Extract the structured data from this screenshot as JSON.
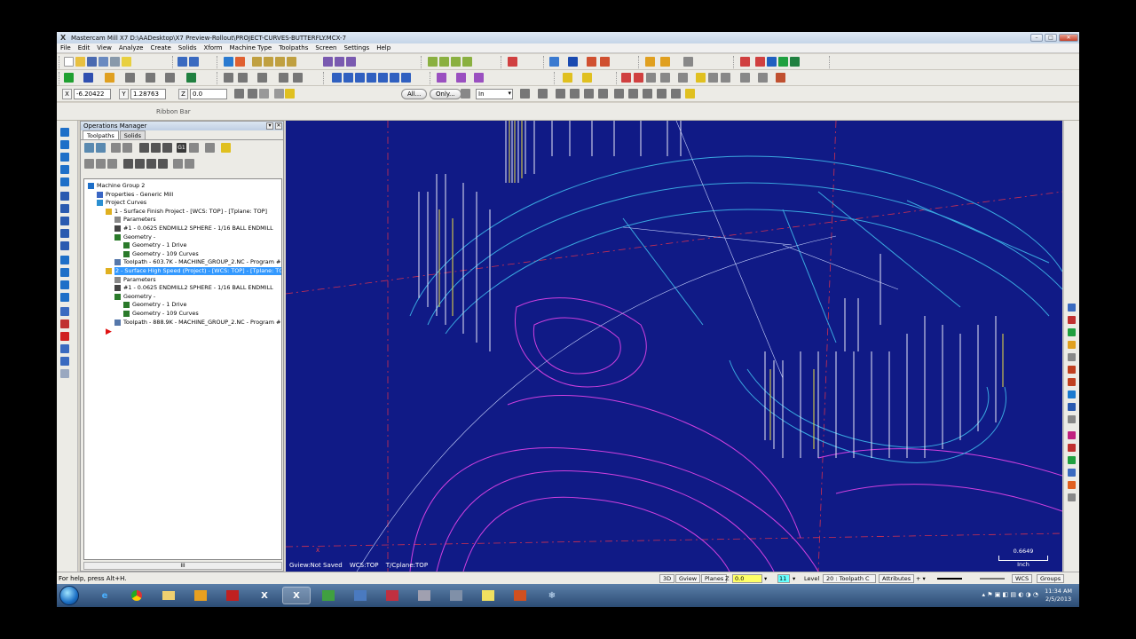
{
  "window": {
    "title": "Mastercam Mill X7  D:\\AADesktop\\X7 Preview-Rollout\\PROJECT-CURVES-BUTTERFLY.MCX-7"
  },
  "menu": [
    "File",
    "Edit",
    "View",
    "Analyze",
    "Create",
    "Solids",
    "Xform",
    "Machine Type",
    "Toolpaths",
    "Screen",
    "Settings",
    "Help"
  ],
  "autocursor": {
    "x_label": "X",
    "x_value": "-6.20422",
    "y_label": "Y",
    "y_value": "1.28763",
    "z_label": "Z",
    "z_value": "0.0"
  },
  "selection": {
    "all_label": "All...",
    "only_label": "Only...",
    "mode_value": "In"
  },
  "ribbon_label": "Ribbon Bar",
  "ops_manager": {
    "title": "Operations Manager",
    "tabs": [
      "Toolpaths",
      "Solids"
    ],
    "tree": [
      {
        "label": "Machine Group 2",
        "depth": 0,
        "icon": "machine-group-icon",
        "color": "#1e6fc8"
      },
      {
        "label": "Properties - Generic Mill",
        "depth": 1,
        "icon": "properties-icon",
        "color": "#3a66c4"
      },
      {
        "label": "Project Curves",
        "depth": 1,
        "icon": "toolpath-group-icon",
        "color": "#2b8fd1"
      },
      {
        "label": "1 - Surface Finish Project - [WCS: TOP] - [Tplane: TOP]",
        "depth": 2,
        "icon": "operation-folder-icon",
        "color": "#e0b020"
      },
      {
        "label": "Parameters",
        "depth": 3,
        "icon": "parameters-icon",
        "color": "#888888"
      },
      {
        "label": "#1 - 0.0625 ENDMILL2 SPHERE - 1/16 BALL ENDMILL",
        "depth": 3,
        "icon": "tool-icon",
        "color": "#444444"
      },
      {
        "label": "Geometry -",
        "depth": 3,
        "icon": "geometry-icon",
        "color": "#2a7a2a"
      },
      {
        "label": "Geometry - 1 Drive",
        "depth": 4,
        "icon": "geometry-drive-icon",
        "color": "#2a7a2a"
      },
      {
        "label": "Geometry - 109 Curves",
        "depth": 4,
        "icon": "geometry-curves-icon",
        "color": "#2a7a2a"
      },
      {
        "label": "Toolpath - 603.7K - MACHINE_GROUP_2.NC - Program #",
        "depth": 3,
        "icon": "toolpath-file-icon",
        "color": "#5577aa"
      },
      {
        "label": "2 - Surface High Speed (Project) - [WCS: TOP] - [Tplane: TO",
        "depth": 2,
        "icon": "operation-folder-icon",
        "color": "#e0b020",
        "selected": true
      },
      {
        "label": "Parameters",
        "depth": 3,
        "icon": "parameters-icon",
        "color": "#888888"
      },
      {
        "label": "#1 - 0.0625 ENDMILL2 SPHERE - 1/16 BALL ENDMILL",
        "depth": 3,
        "icon": "tool-icon",
        "color": "#444444"
      },
      {
        "label": "Geometry -",
        "depth": 3,
        "icon": "geometry-icon",
        "color": "#2a7a2a"
      },
      {
        "label": "Geometry - 1 Drive",
        "depth": 4,
        "icon": "geometry-drive-icon",
        "color": "#2a7a2a"
      },
      {
        "label": "Geometry - 109 Curves",
        "depth": 4,
        "icon": "geometry-curves-icon",
        "color": "#2a7a2a"
      },
      {
        "label": "Toolpath - 888.9K - MACHINE_GROUP_2.NC - Program #",
        "depth": 3,
        "icon": "toolpath-file-icon",
        "color": "#5577aa"
      }
    ],
    "insert_arrow_icon": "insert-arrow-icon",
    "scroll_thumb": "III"
  },
  "viewport": {
    "gview": "Gview:Not Saved",
    "wcs": "WCS:TOP",
    "tcplane": "T/Cplane:TOP",
    "axis_x": "X",
    "scale_value": "0.6649",
    "scale_unit": "Inch",
    "background": "#101a86"
  },
  "statusbar": {
    "help_text": "For help, press Alt+H.",
    "btn_3d": "3D",
    "btn_gview": "Gview",
    "btn_planes": "Planes",
    "z_label": "Z",
    "z_value": "0.0",
    "level_value": "11",
    "level_label": "Level",
    "level_name": "20 : Toolpath C",
    "attributes": "Attributes",
    "wcs": "WCS",
    "groups": "Groups"
  },
  "taskbar": {
    "time": "11:34 AM",
    "date": "2/5/2013"
  }
}
